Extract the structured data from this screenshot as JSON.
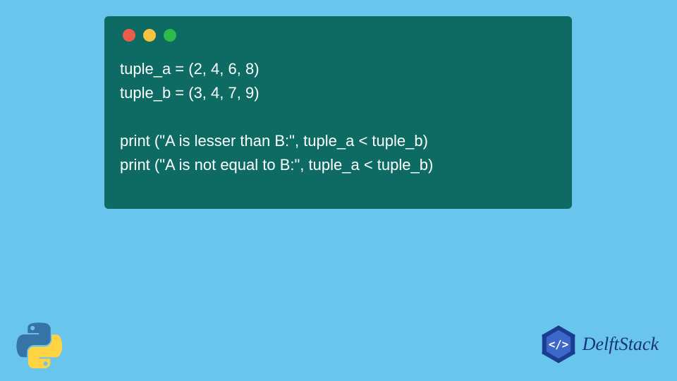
{
  "code": {
    "lines": [
      "tuple_a = (2, 4, 6, 8)",
      "tuple_b = (3, 4, 7, 9)",
      "",
      "print (\"A is lesser than B:\", tuple_a < tuple_b)",
      "print (\"A is not equal to B:\", tuple_a < tuple_b)"
    ]
  },
  "brand": {
    "name": "DelftStack"
  },
  "colors": {
    "background": "#6ac5ed",
    "window": "#0d6b63",
    "code_text": "#ffffff",
    "dot_red": "#ed5b4a",
    "dot_yellow": "#f7c33e",
    "dot_green": "#2cbb4b",
    "brand_text": "#16347a"
  }
}
